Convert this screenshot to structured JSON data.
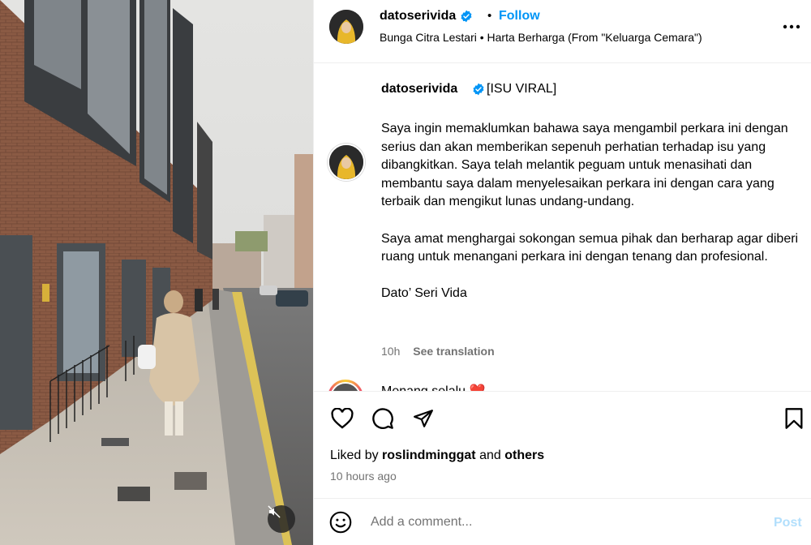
{
  "post": {
    "header": {
      "username": "datoserivida",
      "separator": "•",
      "follow_label": "Follow",
      "audio": "Bunga Citra Lestari • Harta Berharga (From \"Keluarga Cemara\")",
      "more_icon": "more-horizontal-icon"
    },
    "caption": {
      "username": "datoserivida",
      "tag": "[ISU VIRAL]",
      "paragraph_1": "Saya ingin memaklumkan bahawa saya mengambil perkara ini dengan serius dan akan memberikan sepenuh perhatian terhadap isu yang dibangkitkan. Saya telah melantik peguam untuk menasihati dan membantu saya dalam menyelesaikan perkara ini dengan cara yang terbaik dan mengikut lunas undang-undang.",
      "paragraph_2": "Saya amat menghargai sokongan semua pihak dan berharap agar diberi ruang untuk menangani perkara ini dengan tenang dan profesional.",
      "signature": "Dato’ Seri Vida",
      "time": "10h",
      "see_translation": "See translation"
    },
    "next_comment": {
      "text": "Menang selalu ❤️"
    },
    "actions": {
      "like_icon": "heart-icon",
      "comment_icon": "comment-icon",
      "share_icon": "send-icon",
      "save_icon": "bookmark-icon"
    },
    "likes": {
      "prefix": "Liked by",
      "user": "roslindminggat",
      "and": "and",
      "others": "others"
    },
    "time_ago": "10 hours ago",
    "comment_box": {
      "placeholder": "Add a comment...",
      "post_label": "Post",
      "emoji_icon": "emoji-icon"
    },
    "media": {
      "mute_icon": "speaker-muted-icon"
    }
  },
  "colors": {
    "accent": "#0095f6",
    "secondary_text": "#737373",
    "post_disabled": "#b2dffc",
    "divider": "#efefef"
  }
}
